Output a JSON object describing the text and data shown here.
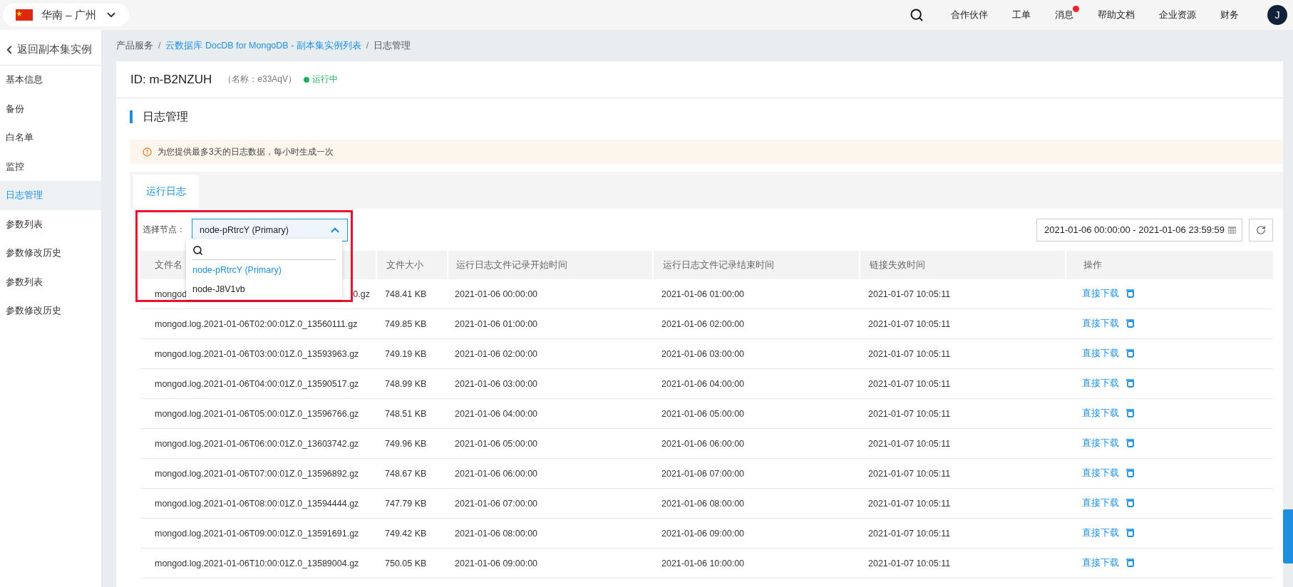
{
  "top_bar": {
    "region": "华南 – 广州",
    "nav": [
      {
        "label": "合作伙伴",
        "badge": false
      },
      {
        "label": "工单",
        "badge": false
      },
      {
        "label": "消息",
        "badge": true
      },
      {
        "label": "帮助文档",
        "badge": false
      },
      {
        "label": "企业资源",
        "badge": false
      },
      {
        "label": "财务",
        "badge": false
      }
    ],
    "avatar": "J"
  },
  "sidebar": {
    "back": "返回副本集实例",
    "items": [
      {
        "label": "基本信息",
        "selected": false
      },
      {
        "label": "备份",
        "selected": false
      },
      {
        "label": "白名单",
        "selected": false
      },
      {
        "label": "监控",
        "selected": false
      },
      {
        "label": "日志管理",
        "selected": true
      },
      {
        "label": "参数列表",
        "selected": false
      },
      {
        "label": "参数修改历史",
        "selected": false
      },
      {
        "label": "参数列表",
        "selected": false
      },
      {
        "label": "参数修改历史",
        "selected": false
      }
    ]
  },
  "breadcrumb": {
    "separator": "/",
    "items": [
      {
        "label": "产品服务",
        "link": false
      },
      {
        "label": "云数据库 DocDB for MongoDB - 副本集实例列表",
        "link": true
      },
      {
        "label": "日志管理",
        "link": false
      }
    ]
  },
  "instance": {
    "id": "ID: m-B2NZUH",
    "name": "（名称：e33AqV）",
    "status": "运行中"
  },
  "section_title": "日志管理",
  "notice": "为您提供最多3天的日志数据，每小时生成一次",
  "tabs": [
    {
      "label": "运行日志",
      "selected": true
    }
  ],
  "node_select": {
    "label": "选择节点：",
    "value": "node-pRtrcY (Primary)",
    "expanded": true,
    "highlighted": true,
    "options": [
      {
        "label": "node-pRtrcY (Primary)",
        "selected": true
      },
      {
        "label": "node-J8V1vb",
        "selected": false
      }
    ]
  },
  "date_range": "2021-01-06 00:00:00 - 2021-01-06 23:59:59",
  "table": {
    "columns": [
      "文件名",
      "文件大小",
      "运行日志文件记录开始时间",
      "运行日志文件记录结束时间",
      "链接失效时间",
      "操作"
    ],
    "rows": [
      {
        "file_name": "mongod",
        "file_name_end": "0.gz",
        "file_size": "748.41 KB",
        "start": "2021-01-06 00:00:00",
        "end": "2021-01-06 01:00:00",
        "expires": "2021-01-07 10:05:11",
        "action": "直接下载"
      },
      {
        "file_name": "mongod.log.2021-01-06T02:00:01Z.0_13560111.gz",
        "file_size": "749.85 KB",
        "start": "2021-01-06 01:00:00",
        "end": "2021-01-06 02:00:00",
        "expires": "2021-01-07 10:05:11",
        "action": "直接下载"
      },
      {
        "file_name": "mongod.log.2021-01-06T03:00:01Z.0_13593963.gz",
        "file_size": "749.19 KB",
        "start": "2021-01-06 02:00:00",
        "end": "2021-01-06 03:00:00",
        "expires": "2021-01-07 10:05:11",
        "action": "直接下载"
      },
      {
        "file_name": "mongod.log.2021-01-06T04:00:01Z.0_13590517.gz",
        "file_size": "748.99 KB",
        "start": "2021-01-06 03:00:00",
        "end": "2021-01-06 04:00:00",
        "expires": "2021-01-07 10:05:11",
        "action": "直接下载"
      },
      {
        "file_name": "mongod.log.2021-01-06T05:00:01Z.0_13596766.gz",
        "file_size": "748.51 KB",
        "start": "2021-01-06 04:00:00",
        "end": "2021-01-06 05:00:00",
        "expires": "2021-01-07 10:05:11",
        "action": "直接下载"
      },
      {
        "file_name": "mongod.log.2021-01-06T06:00:01Z.0_13603742.gz",
        "file_size": "749.96 KB",
        "start": "2021-01-06 05:00:00",
        "end": "2021-01-06 06:00:00",
        "expires": "2021-01-07 10:05:11",
        "action": "直接下载"
      },
      {
        "file_name": "mongod.log.2021-01-06T07:00:01Z.0_13596892.gz",
        "file_size": "748.67 KB",
        "start": "2021-01-06 06:00:00",
        "end": "2021-01-06 07:00:00",
        "expires": "2021-01-07 10:05:11",
        "action": "直接下载"
      },
      {
        "file_name": "mongod.log.2021-01-06T08:00:01Z.0_13594444.gz",
        "file_size": "747.79 KB",
        "start": "2021-01-06 07:00:00",
        "end": "2021-01-06 08:00:00",
        "expires": "2021-01-07 10:05:11",
        "action": "直接下载"
      },
      {
        "file_name": "mongod.log.2021-01-06T09:00:01Z.0_13591691.gz",
        "file_size": "749.42 KB",
        "start": "2021-01-06 08:00:00",
        "end": "2021-01-06 09:00:00",
        "expires": "2021-01-07 10:05:11",
        "action": "直接下载"
      },
      {
        "file_name": "mongod.log.2021-01-06T10:00:01Z.0_13589004.gz",
        "file_size": "750.05 KB",
        "start": "2021-01-06 09:00:00",
        "end": "2021-01-06 10:00:00",
        "expires": "2021-01-07 10:05:11",
        "action": "直接下载"
      }
    ]
  }
}
